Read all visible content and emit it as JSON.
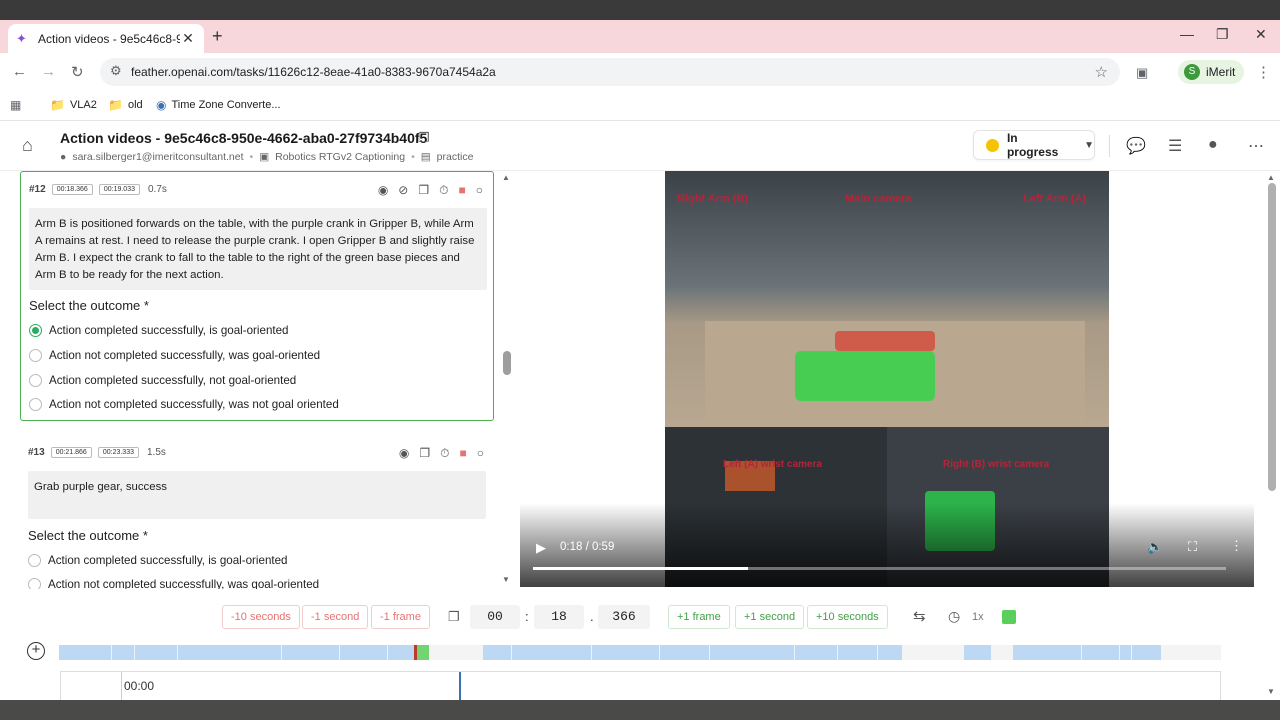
{
  "browser": {
    "tab_title": "Action videos - 9e5c46c8-950e",
    "url": "feather.openai.com/tasks/11626c12-8eae-41a0-8383-9670a7454a2a",
    "profile_initial": "S",
    "profile_name": "iMerit",
    "bookmarks": [
      {
        "label": "VLA2",
        "icon": "folder-icon"
      },
      {
        "label": "old",
        "icon": "folder-icon"
      },
      {
        "label": "Time Zone Converte...",
        "icon": "timezone-icon"
      }
    ]
  },
  "header": {
    "title": "Action videos - 9e5c46c8-950e-4662-aba0-27f9734b40f5",
    "user": "sara.silberger1@imeritconsultant.net",
    "project": "Robotics RTGv2 Captioning",
    "queue": "practice",
    "status": "In progress"
  },
  "segments": [
    {
      "number": "#12",
      "start": "00:18.366",
      "end": "00:19.033",
      "duration": "0.7s",
      "description": "Arm B is positioned forwards on the table, with the purple crank in Gripper B, while Arm A remains at rest. I need to release the purple crank. I open Gripper B and slightly raise Arm B. I expect the crank to fall to the table to the right of the green base pieces and Arm B to be ready for the next action.",
      "question": "Select the outcome  *",
      "options": [
        {
          "label": "Action completed successfully, is goal-oriented",
          "selected": true
        },
        {
          "label": "Action not completed successfully, was goal-oriented",
          "selected": false
        },
        {
          "label": "Action completed successfully, not goal-oriented",
          "selected": false
        },
        {
          "label": "Action not completed successfully, was not goal oriented",
          "selected": false
        }
      ]
    },
    {
      "number": "#13",
      "start": "00:21.866",
      "end": "00:23.333",
      "duration": "1.5s",
      "description": "Grab purple gear, success",
      "question": "Select the outcome  *",
      "options": [
        {
          "label": "Action completed successfully, is goal-oriented",
          "selected": false
        },
        {
          "label": "Action not completed successfully, was goal-oriented",
          "selected": false
        }
      ]
    }
  ],
  "video": {
    "labels": {
      "right_arm": "Right Arm (B)",
      "main": "Main camera",
      "left_arm": "Left Arm (A)",
      "left_wrist": "Left (A) wrist camera",
      "right_wrist": "Right (B) wrist camera"
    },
    "time": "0:18 / 0:59",
    "progress": 0.31
  },
  "frame_controls": {
    "back10": "-10 seconds",
    "back1": "-1 second",
    "back_frame": "-1 frame",
    "minutes": "00",
    "seconds": "18",
    "millis": "366",
    "fwd_frame": "+1 frame",
    "fwd1": "+1 second",
    "fwd10": "+10 seconds",
    "speed": "1x"
  },
  "timeline": {
    "start_label": "00:00"
  },
  "colors": {
    "accent_green": "#4caf50",
    "status_yellow": "#f5c400",
    "segment_blue": "#bcd8f2",
    "tab_bar_pink": "#f7d7dc"
  }
}
